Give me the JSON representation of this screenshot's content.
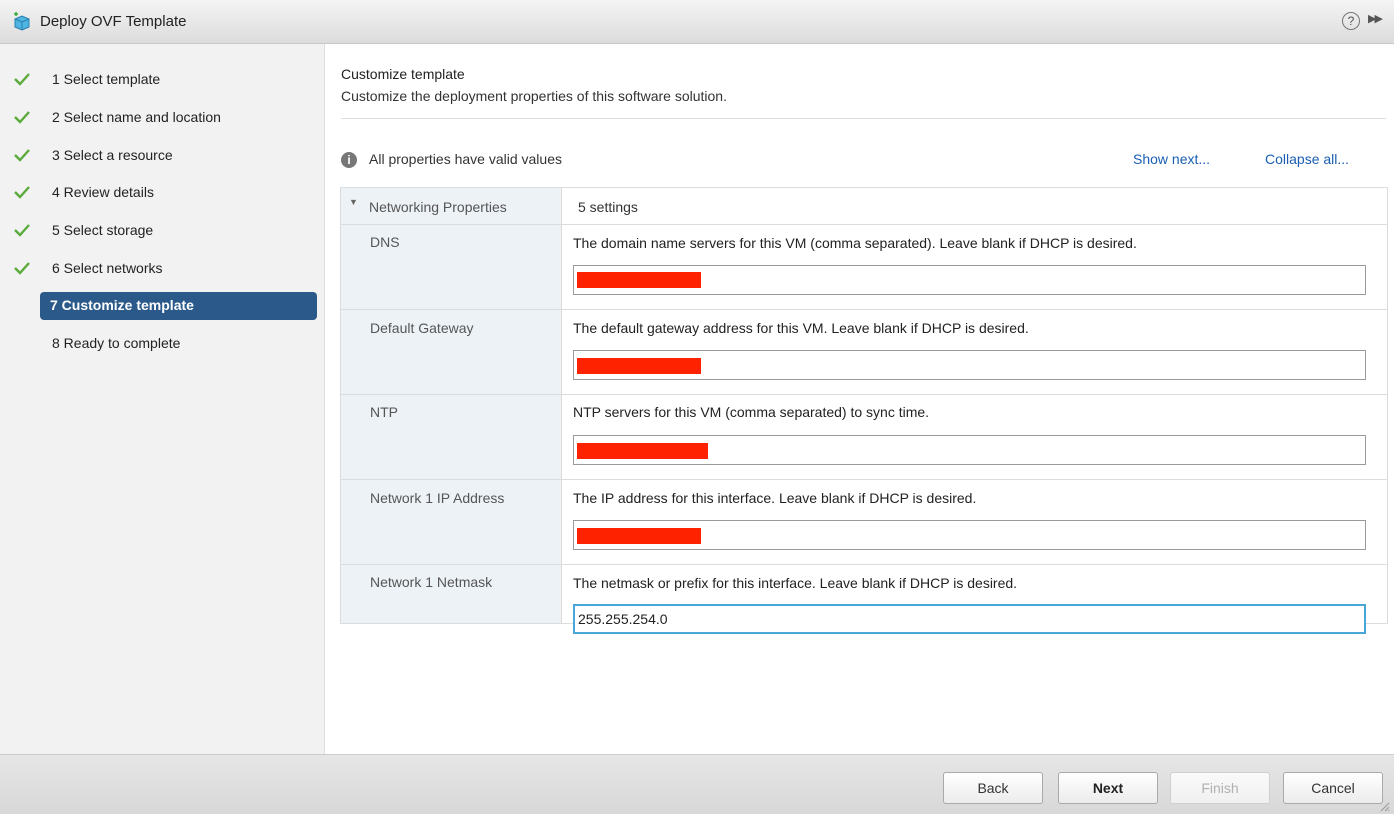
{
  "window": {
    "title": "Deploy OVF Template",
    "help_glyph": "?",
    "expand_glyph": "▶▶"
  },
  "steps": [
    {
      "label": "1  Select template",
      "done": true
    },
    {
      "label": "2  Select name and location",
      "done": true
    },
    {
      "label": "3  Select a resource",
      "done": true
    },
    {
      "label": "4  Review details",
      "done": true
    },
    {
      "label": "5  Select storage",
      "done": true
    },
    {
      "label": "6  Select networks",
      "done": true
    },
    {
      "label": "7 Customize template",
      "active": true
    },
    {
      "label": "8 Ready to complete",
      "done": false
    }
  ],
  "content": {
    "title": "Customize template",
    "subtitle": "Customize the deployment properties of this software solution.",
    "status": "All properties have valid values",
    "info_glyph": "i",
    "links": {
      "show_next": "Show next...",
      "collapse_all": "Collapse all..."
    }
  },
  "group": {
    "arrow": "▼",
    "label": "Networking Properties",
    "value": "5 settings"
  },
  "properties": [
    {
      "label": "DNS",
      "description": "The domain name servers for this VM (comma separated). Leave blank if DHCP is desired.",
      "value": "",
      "redacted": true
    },
    {
      "label": "Default Gateway",
      "description": "The default gateway address for this VM. Leave blank if DHCP is desired.",
      "value": "",
      "redacted": true
    },
    {
      "label": "NTP",
      "description": "NTP servers for this VM (comma separated) to sync time.",
      "value": "",
      "redacted": true
    },
    {
      "label": "Network 1 IP Address",
      "description": "The IP address for this interface. Leave blank if DHCP is desired.",
      "value": "",
      "redacted": true
    },
    {
      "label": "Network 1 Netmask",
      "description": "The netmask or prefix for this interface. Leave blank if DHCP is desired.",
      "value": "255.255.254.0",
      "redacted": false
    }
  ],
  "buttons": {
    "back": "Back",
    "next": "Next",
    "finish": "Finish",
    "cancel": "Cancel"
  },
  "colors": {
    "accent": "#2b5a8a",
    "check": "#5aab3c",
    "link": "#1a5fb4",
    "redaction": "#ff2200",
    "focus": "#4aa6d6"
  },
  "icons": {
    "title": "ovf-template-icon",
    "step_done": "checkmark-icon",
    "info": "info-icon",
    "group_toggle": "triangle-down-icon"
  }
}
